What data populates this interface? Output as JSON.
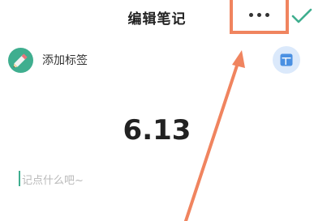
{
  "header": {
    "title": "编辑笔记",
    "more_icon": "more-horizontal-icon",
    "confirm_icon": "checkmark-icon"
  },
  "tag": {
    "label": "添加标签",
    "icon": "pencil-icon"
  },
  "layout_button": {
    "icon": "layout-template-icon"
  },
  "note": {
    "title": "6.13",
    "placeholder": "记点什么吧~"
  },
  "colors": {
    "accent_green": "#3fae8f",
    "annotation_orange": "#f0845f",
    "layout_bg": "#dbe9fb"
  }
}
